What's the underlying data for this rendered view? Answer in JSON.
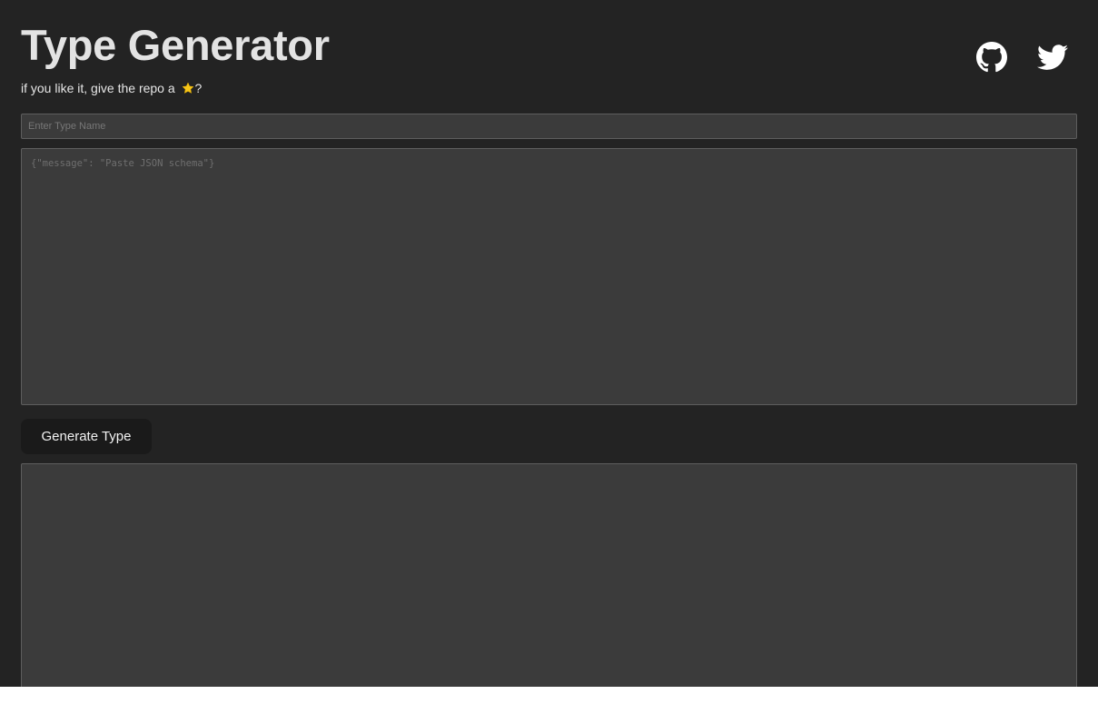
{
  "header": {
    "title": "Type Generator",
    "subtitle_prefix": "if you like it, give the repo a ",
    "subtitle_star_icon": "star-emoji",
    "subtitle_suffix": "?"
  },
  "social": {
    "github_icon": "github-icon",
    "twitter_icon": "twitter-icon"
  },
  "form": {
    "type_name": {
      "value": "",
      "placeholder": "Enter Type Name"
    },
    "schema": {
      "value": "",
      "placeholder": "{\"message\": \"Paste JSON schema\"}"
    },
    "generate_label": "Generate Type",
    "output": {
      "value": ""
    }
  },
  "colors": {
    "background": "#232323",
    "field_background": "#3b3b3b",
    "field_border": "#5e5e5e",
    "button_background": "#1a1a1a",
    "title_text": "#e3e3e3",
    "star": "#f5c518"
  }
}
